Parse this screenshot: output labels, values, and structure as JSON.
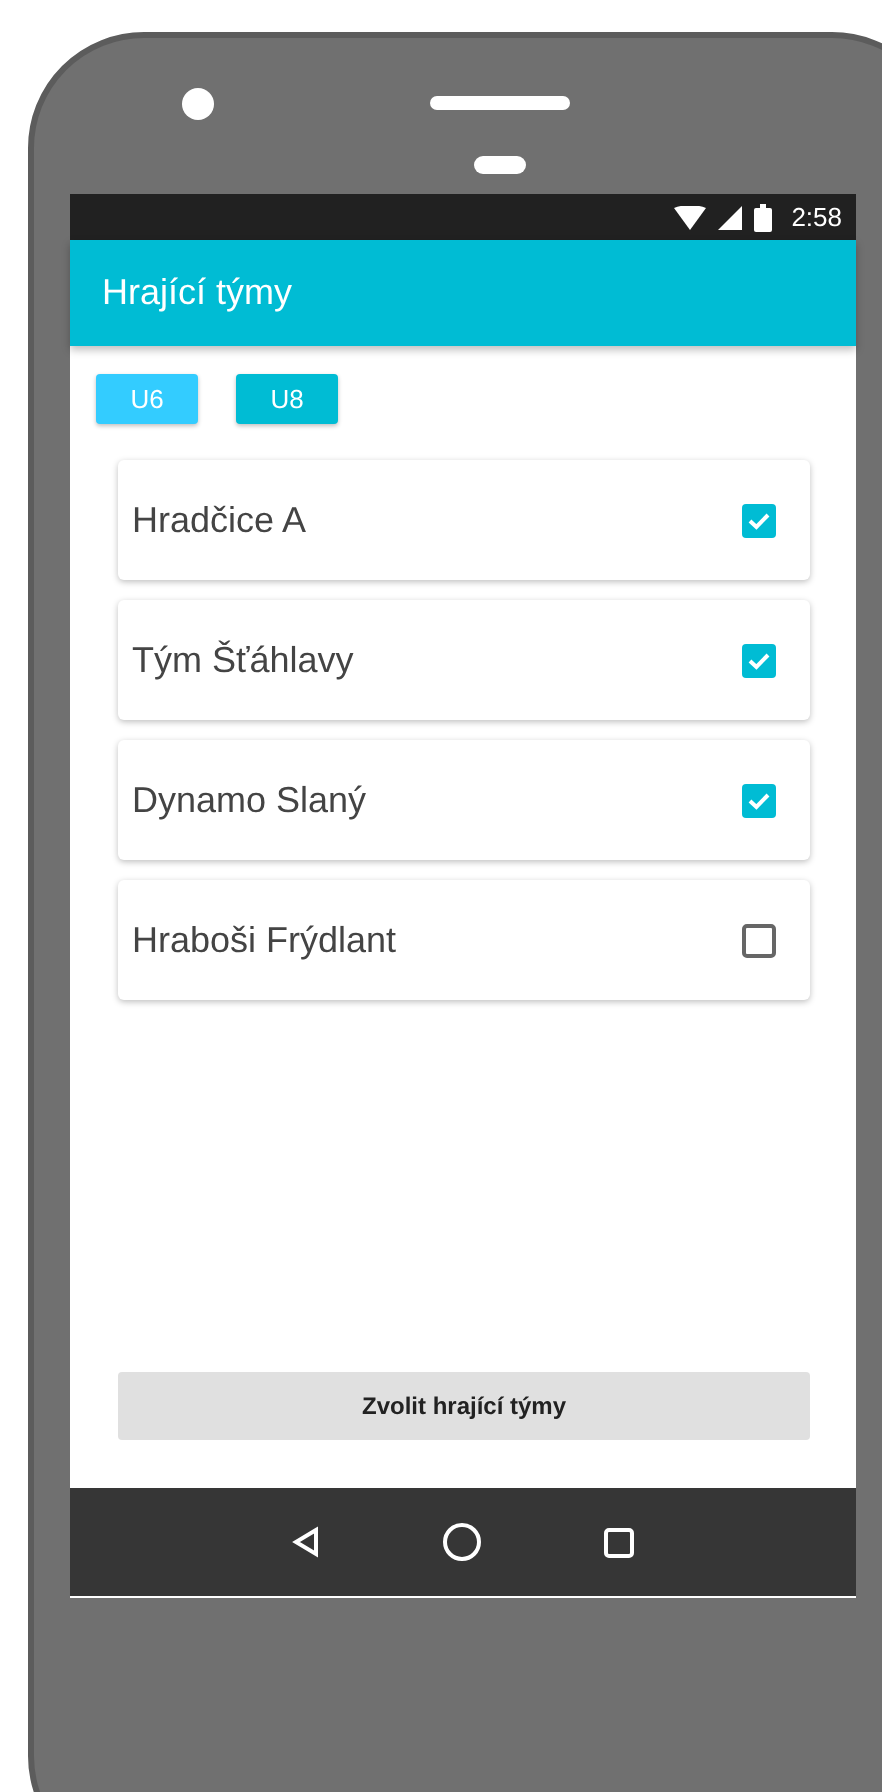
{
  "status_bar": {
    "time": "2:58"
  },
  "app_bar": {
    "title": "Hrající týmy"
  },
  "categories": [
    {
      "label": "U6",
      "selected": true
    },
    {
      "label": "U8",
      "selected": false
    }
  ],
  "teams": [
    {
      "name": "Hradčice A",
      "checked": true
    },
    {
      "name": "Tým Šťáhlavy",
      "checked": true
    },
    {
      "name": "Dynamo Slaný",
      "checked": true
    },
    {
      "name": "Hraboši Frýdlant",
      "checked": false
    }
  ],
  "action_button": {
    "label": "Zvolit hrající týmy"
  }
}
